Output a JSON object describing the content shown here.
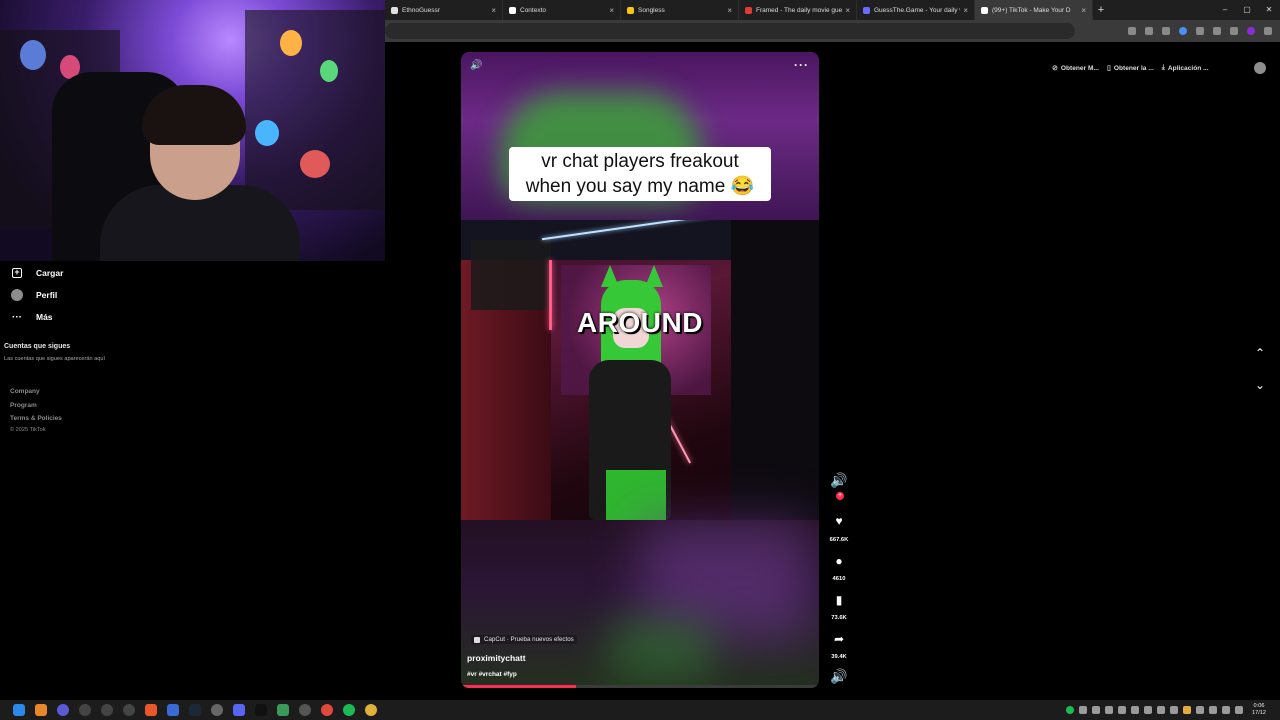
{
  "browser": {
    "tabs": [
      {
        "label": "EthnoGuessr",
        "favicon_color": "#e0e0e0",
        "active": false
      },
      {
        "label": "Contexto",
        "favicon_color": "#ffffff",
        "active": false
      },
      {
        "label": "Songless",
        "favicon_color": "#f5c518",
        "active": false
      },
      {
        "label": "Framed - The daily movie gue",
        "favicon_color": "#e03a3a",
        "active": false
      },
      {
        "label": "GuessThe.Game - Your daily vi",
        "favicon_color": "#6a6aff",
        "active": false
      },
      {
        "label": "(99+) TikTok - Make Your D",
        "favicon_color": "#ffffff",
        "active": true
      }
    ],
    "new_tab_icon": "+",
    "close_icon": "×",
    "window_controls": [
      "–",
      "▢",
      "✕"
    ]
  },
  "sidebar": {
    "items": [
      {
        "label": "Cargar",
        "icon": "upload-icon"
      },
      {
        "label": "Perfil",
        "icon": "profile-avatar"
      },
      {
        "label": "Más",
        "icon": "more-icon"
      }
    ],
    "following_title": "Cuentas que sigues",
    "following_desc": "Las cuentas que sigues aparecerán aquí",
    "footer_links": [
      "Company",
      "Program",
      "Terms & Policies"
    ],
    "copyright": "© 2025 TikTok"
  },
  "header": {
    "actions": [
      {
        "label": "Obtener M...",
        "icon": "coin-icon"
      },
      {
        "label": "Obtener la ...",
        "icon": "phone-icon"
      },
      {
        "label": "Aplicación ...",
        "icon": "download-icon"
      }
    ]
  },
  "video": {
    "caption_line1": "vr chat players freakout",
    "caption_line2": "when you say my name 😂",
    "overlay_text": "AROUND",
    "capcut_label": "CapCut · Prueba nuevos efectos",
    "author": "proximitychatt",
    "hashtags": "#vr #vrchat #fyp",
    "progress": 0.32,
    "volume_icon": "🔊",
    "more_icon": "···"
  },
  "actions": {
    "likes": "667.6K",
    "comments": "4610",
    "saves": "73.6K",
    "shares": "39.4K",
    "plus_icon": "+",
    "accent_color": "#fe2c55"
  },
  "taskbar": {
    "time": "0:06",
    "date": "17/12"
  }
}
